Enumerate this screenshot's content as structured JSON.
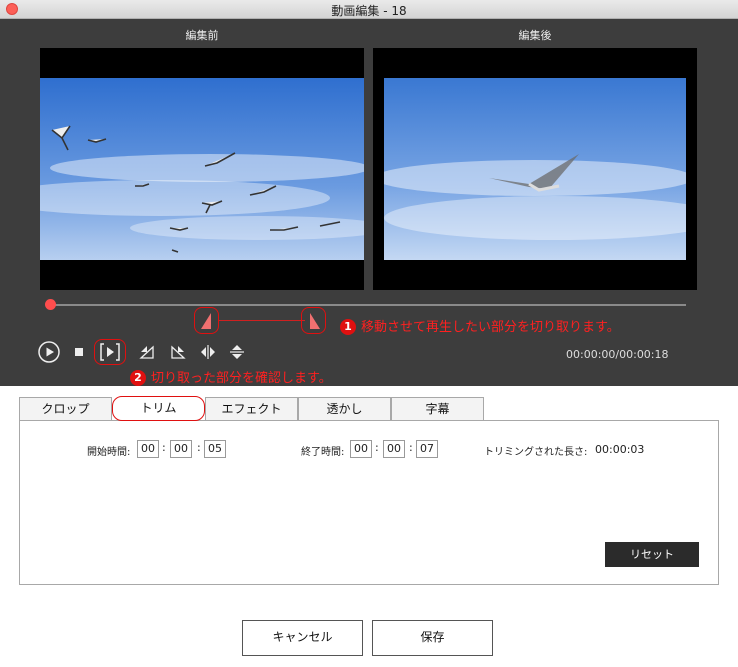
{
  "window": {
    "title": "動画編集 - 18"
  },
  "preview": {
    "before_label": "編集前",
    "after_label": "編集後",
    "time": "00:00:00/00:00:18"
  },
  "notes": {
    "note1_num": "1",
    "note1_text": "移動させて再生したい部分を切り取ります。",
    "note2_num": "2",
    "note2_text": "切り取った部分を確認します。"
  },
  "controls": [
    "play-icon",
    "stop-icon",
    "trim-preview-icon",
    "rotate-left-icon",
    "rotate-right-icon",
    "flip-horizontal-icon",
    "flip-vertical-icon"
  ],
  "tabs": [
    "クロップ",
    "トリム",
    "エフェクト",
    "透かし",
    "字幕"
  ],
  "active_tab": "トリム",
  "trim": {
    "start_label": "開始時間:",
    "start": [
      "00",
      "00",
      "05"
    ],
    "end_label": "終了時間:",
    "end": [
      "00",
      "00",
      "07"
    ],
    "length_label": "トリミングされた長さ:",
    "length": "00:00:03",
    "colon": ":",
    "reset": "リセット"
  },
  "buttons": {
    "cancel": "キャンセル",
    "save": "保存"
  },
  "colors": {
    "accent": "#e01010",
    "editor_bg": "#3d3d3d",
    "seek": "#ff4d4d"
  }
}
